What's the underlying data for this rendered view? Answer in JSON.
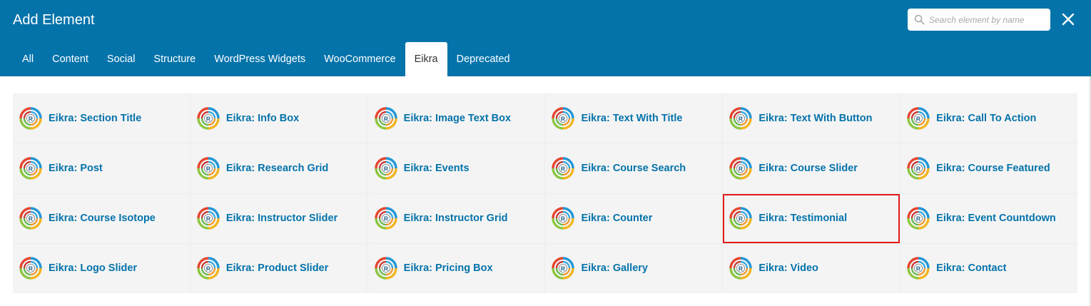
{
  "window": {
    "title": "Add Element"
  },
  "search": {
    "placeholder": "Search element by name",
    "icon": "search-icon"
  },
  "close": {
    "icon": "close-icon"
  },
  "tabs": [
    {
      "label": "All",
      "active": false
    },
    {
      "label": "Content",
      "active": false
    },
    {
      "label": "Social",
      "active": false
    },
    {
      "label": "Structure",
      "active": false
    },
    {
      "label": "WordPress Widgets",
      "active": false
    },
    {
      "label": "WooCommerce",
      "active": false
    },
    {
      "label": "Eikra",
      "active": true
    },
    {
      "label": "Deprecated",
      "active": false
    }
  ],
  "elements": [
    {
      "label": "Eikra: Section Title",
      "icon": "eikra-logo-icon"
    },
    {
      "label": "Eikra: Info Box",
      "icon": "eikra-logo-icon"
    },
    {
      "label": "Eikra: Image Text Box",
      "icon": "eikra-logo-icon"
    },
    {
      "label": "Eikra: Text With Title",
      "icon": "eikra-logo-icon"
    },
    {
      "label": "Eikra: Text With Button",
      "icon": "eikra-logo-icon"
    },
    {
      "label": "Eikra: Call To Action",
      "icon": "eikra-logo-icon"
    },
    {
      "label": "Eikra: Post",
      "icon": "eikra-logo-icon"
    },
    {
      "label": "Eikra: Research Grid",
      "icon": "eikra-logo-icon"
    },
    {
      "label": "Eikra: Events",
      "icon": "eikra-logo-icon"
    },
    {
      "label": "Eikra: Course Search",
      "icon": "eikra-logo-icon"
    },
    {
      "label": "Eikra: Course Slider",
      "icon": "eikra-logo-icon"
    },
    {
      "label": "Eikra: Course Featured",
      "icon": "eikra-logo-icon"
    },
    {
      "label": "Eikra: Course Isotope",
      "icon": "eikra-logo-icon"
    },
    {
      "label": "Eikra: Instructor Slider",
      "icon": "eikra-logo-icon"
    },
    {
      "label": "Eikra: Instructor Grid",
      "icon": "eikra-logo-icon"
    },
    {
      "label": "Eikra: Counter",
      "icon": "eikra-logo-icon"
    },
    {
      "label": "Eikra: Testimonial",
      "icon": "eikra-logo-icon",
      "highlighted": true
    },
    {
      "label": "Eikra: Event Countdown",
      "icon": "eikra-logo-icon"
    },
    {
      "label": "Eikra: Logo Slider",
      "icon": "eikra-logo-icon"
    },
    {
      "label": "Eikra: Product Slider",
      "icon": "eikra-logo-icon"
    },
    {
      "label": "Eikra: Pricing Box",
      "icon": "eikra-logo-icon"
    },
    {
      "label": "Eikra: Gallery",
      "icon": "eikra-logo-icon"
    },
    {
      "label": "Eikra: Video",
      "icon": "eikra-logo-icon"
    },
    {
      "label": "Eikra: Contact",
      "icon": "eikra-logo-icon"
    }
  ],
  "colors": {
    "header": "#0473aa",
    "link": "#0473aa",
    "highlight": "#e01b1b",
    "cell": "#f4f4f4"
  }
}
